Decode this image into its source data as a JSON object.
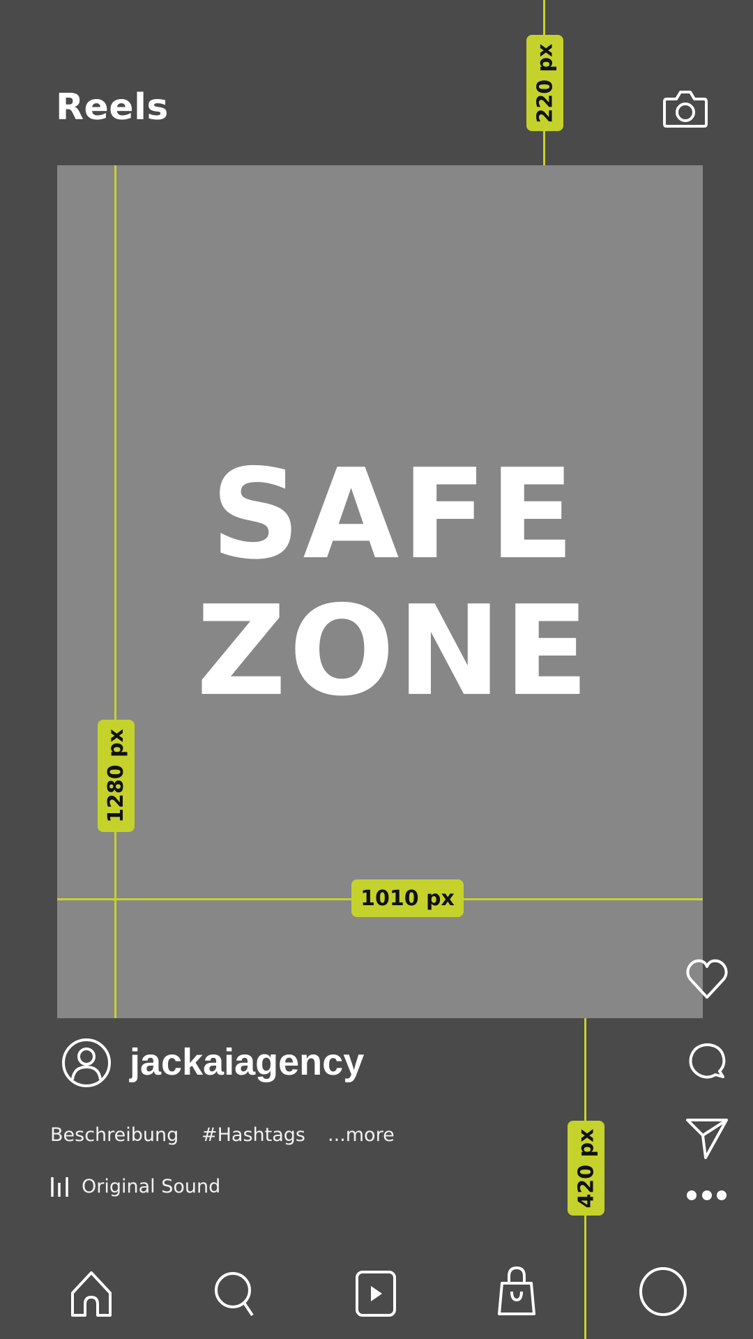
{
  "header": {
    "title": "Reels",
    "camera_icon": "camera-icon"
  },
  "overlay": {
    "safe_zone_line1": "SAFE",
    "safe_zone_line2": "ZONE",
    "guide_color": "#c5d22b",
    "safe_area_color": "#878787",
    "background_color": "#4a4a4a",
    "measurements": {
      "top_margin": "220 px",
      "safe_height": "1280 px",
      "safe_width": "1010 px",
      "bottom_margin": "420 px"
    }
  },
  "post": {
    "username": "jackaiagency",
    "avatar_icon": "user-avatar-icon",
    "caption": {
      "description": "Beschreibung",
      "hashtags": "#Hashtags",
      "more": "...more"
    },
    "audio_label": "Original Sound"
  },
  "actions": [
    "heart-icon",
    "comment-icon",
    "share-icon",
    "more-icon"
  ],
  "bottom_nav": [
    "home-icon",
    "search-icon",
    "reels-icon",
    "shop-icon",
    "profile-icon"
  ]
}
